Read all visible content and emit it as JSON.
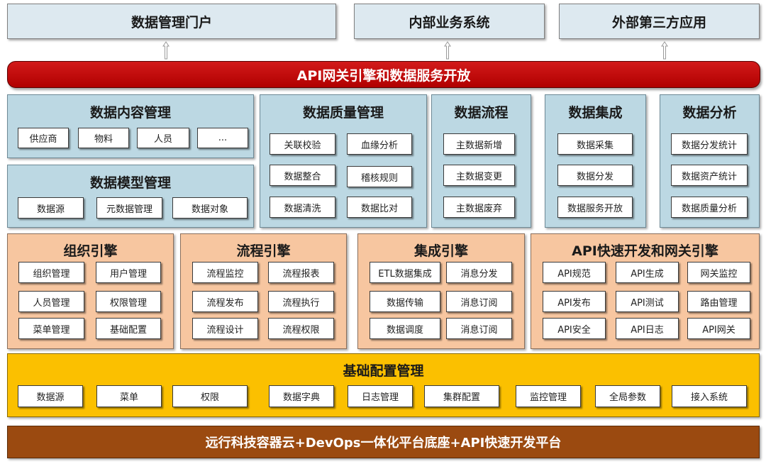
{
  "top": [
    "数据管理门户",
    "内部业务系统",
    "外部第三方应用"
  ],
  "gateway": "API网关引擎和数据服务开放",
  "content_mgmt": {
    "title": "数据内容管理",
    "items": [
      "供应商",
      "物料",
      "人员",
      "..."
    ]
  },
  "model_mgmt": {
    "title": "数据模型管理",
    "items": [
      "数据源",
      "元数据管理",
      "数据对象"
    ]
  },
  "quality_mgmt": {
    "title": "数据质量管理",
    "items": [
      "关联校验",
      "血缘分析",
      "数据整合",
      "稽核规则",
      "数据清洗",
      "数据比对"
    ]
  },
  "data_flow": {
    "title": "数据流程",
    "items": [
      "主数据新增",
      "主数据变更",
      "主数据废弃"
    ]
  },
  "data_integration": {
    "title": "数据集成",
    "items": [
      "数据采集",
      "数据分发",
      "数据服务开放"
    ]
  },
  "data_analysis": {
    "title": "数据分析",
    "items": [
      "数据分发统计",
      "数据资产统计",
      "数据质量分析"
    ]
  },
  "org_engine": {
    "title": "组织引擎",
    "items": [
      "组织管理",
      "用户管理",
      "人员管理",
      "权限管理",
      "菜单管理",
      "基础配置"
    ]
  },
  "flow_engine": {
    "title": "流程引擎",
    "items": [
      "流程监控",
      "流程报表",
      "流程发布",
      "流程执行",
      "流程设计",
      "流程权限"
    ]
  },
  "integ_engine": {
    "title": "集成引擎",
    "items": [
      "ETL数据集成",
      "消息分发",
      "数据传输",
      "消息订阅",
      "数据调度",
      "消息订阅"
    ]
  },
  "api_engine": {
    "title": "API快速开发和网关引擎",
    "items": [
      "API规范",
      "API生成",
      "网关监控",
      "API发布",
      "API测试",
      "路由管理",
      "API安全",
      "API日志",
      "API网关"
    ]
  },
  "base_config": {
    "title": "基础配置管理",
    "items": [
      "数据源",
      "菜单",
      "权限",
      "数据字典",
      "日志管理",
      "集群配置",
      "监控管理",
      "全局参数",
      "接入系统"
    ]
  },
  "platform": "远行科技容器云+DevOps一体化平台底座+API快速开发平台"
}
